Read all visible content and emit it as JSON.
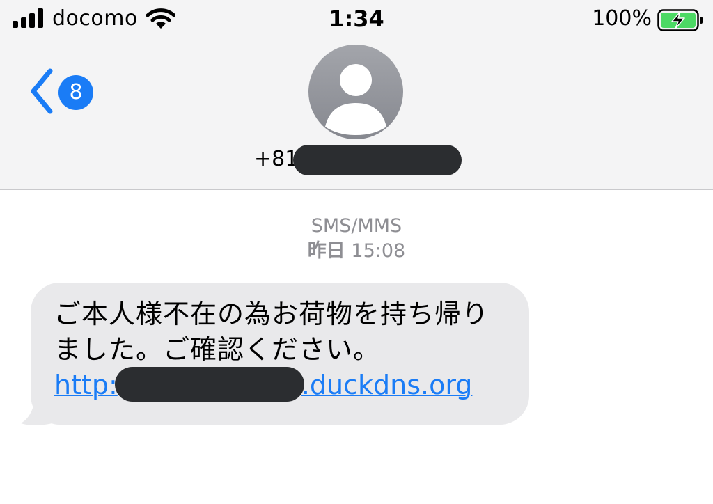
{
  "status_bar": {
    "carrier": "docomo",
    "time": "1:34",
    "battery_percent": "100%",
    "signal_icon": "cellular-signal-icon",
    "wifi_icon": "wifi-icon",
    "battery_icon": "battery-charging-icon",
    "battery_color": "#4cd964"
  },
  "header": {
    "back_badge_count": "8",
    "contact_prefix": "+81",
    "accent_color": "#1a7cf6",
    "avatar_icon": "person-avatar-icon"
  },
  "conversation": {
    "service_label": "SMS/MMS",
    "day_label": "昨日",
    "time_label": "15:08",
    "messages": [
      {
        "text": "ご本人様不在の為お荷物を持ち帰りました。ご確認ください。",
        "link_prefix": "http:",
        "link_suffix": ".duckdns.org",
        "bubble_color": "#e9e9eb"
      }
    ]
  }
}
